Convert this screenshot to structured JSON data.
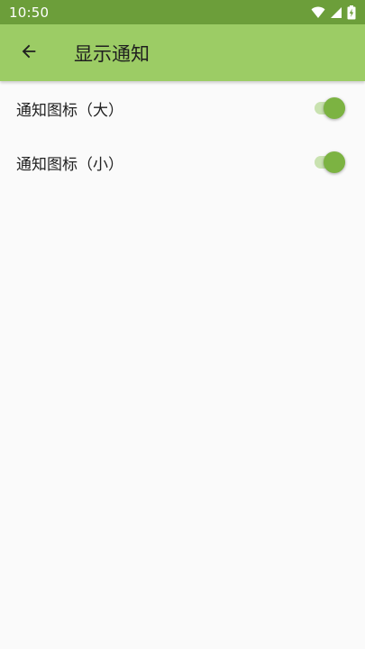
{
  "status_bar": {
    "time": "10:50",
    "icons": [
      "wifi-icon",
      "cell-signal-icon",
      "battery-charging-icon"
    ]
  },
  "app_bar": {
    "back_icon": "arrow-back-icon",
    "title": "显示通知"
  },
  "settings": [
    {
      "label": "通知图标（大）",
      "enabled": true
    },
    {
      "label": "通知图标（小）",
      "enabled": true
    }
  ],
  "colors": {
    "status_bar": "#6c9e3a",
    "app_bar": "#9ccc65",
    "switch_thumb": "#7cb342",
    "switch_track": "#c9e2b0",
    "background": "#fafafa"
  }
}
